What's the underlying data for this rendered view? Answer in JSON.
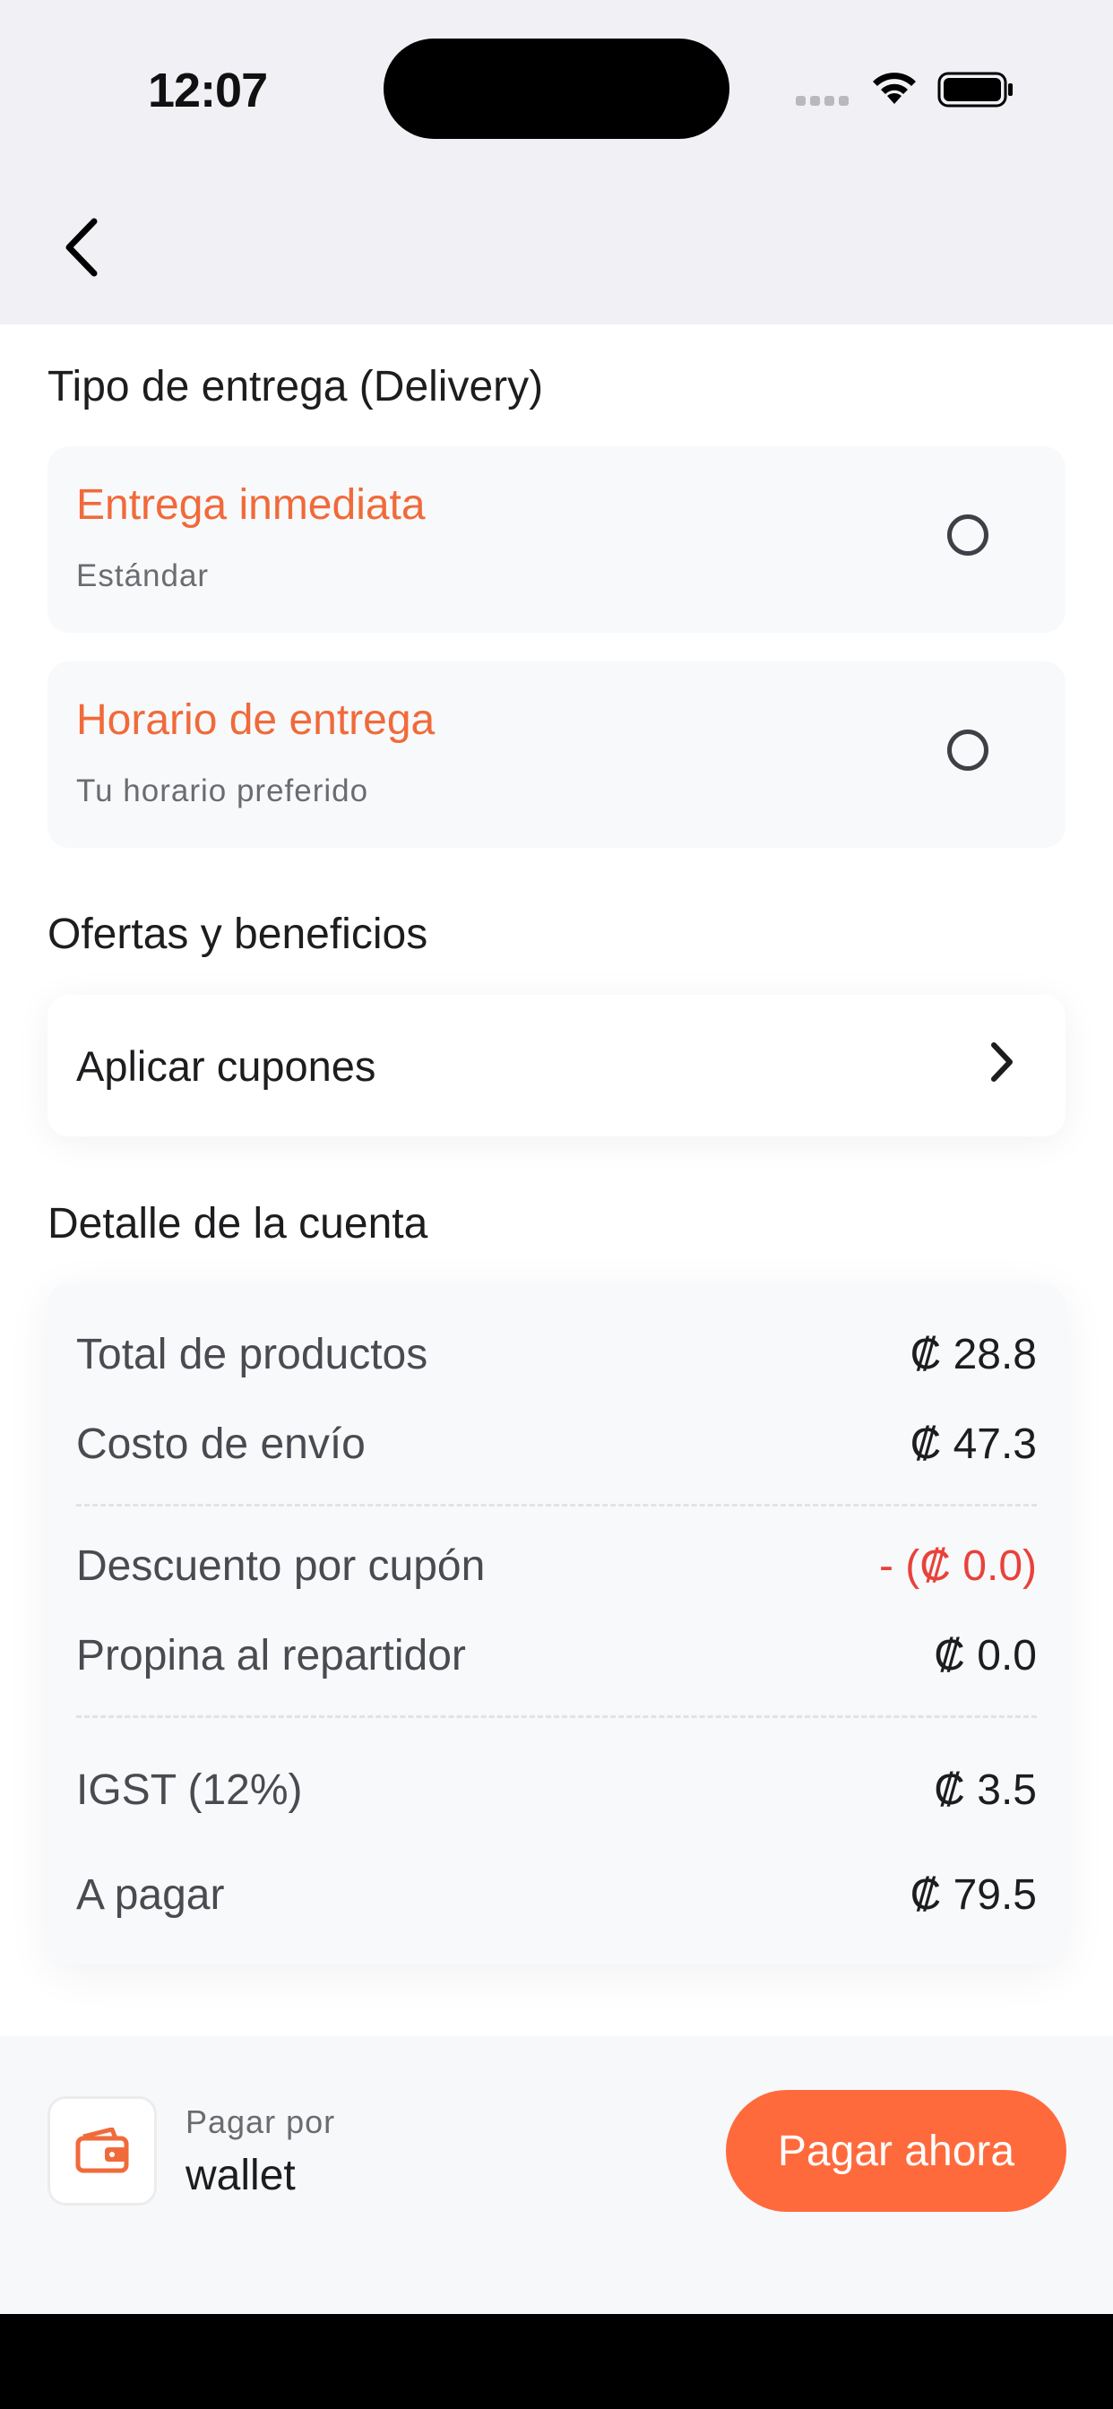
{
  "status_bar": {
    "time": "12:07"
  },
  "delivery": {
    "section_title": "Tipo de entrega (Delivery)",
    "options": [
      {
        "title": "Entrega inmediata",
        "subtitle": "Estándar"
      },
      {
        "title": "Horario de entrega",
        "subtitle": "Tu horario preferido"
      }
    ]
  },
  "offers": {
    "section_title": "Ofertas y beneficios",
    "apply_coupons": "Aplicar cupones"
  },
  "bill": {
    "section_title": "Detalle de la cuenta",
    "rows": [
      {
        "label": "Total de productos",
        "value": "₡ 28.8"
      },
      {
        "label": "Costo de envío",
        "value": "₡ 47.3"
      },
      {
        "label": "Descuento por cupón",
        "value": "- (₡ 0.0)"
      },
      {
        "label": "Propina al repartidor",
        "value": "₡ 0.0"
      },
      {
        "label": "IGST (12%)",
        "value": "₡ 3.5"
      },
      {
        "label": "A pagar",
        "value": "₡ 79.5"
      }
    ]
  },
  "footer": {
    "pay_by_label": "Pagar por",
    "pay_method": "wallet",
    "pay_button": "Pagar ahora"
  },
  "colors": {
    "accent": "#ff6a3d",
    "option_title": "#f06a3a",
    "discount": "#e8423a"
  }
}
